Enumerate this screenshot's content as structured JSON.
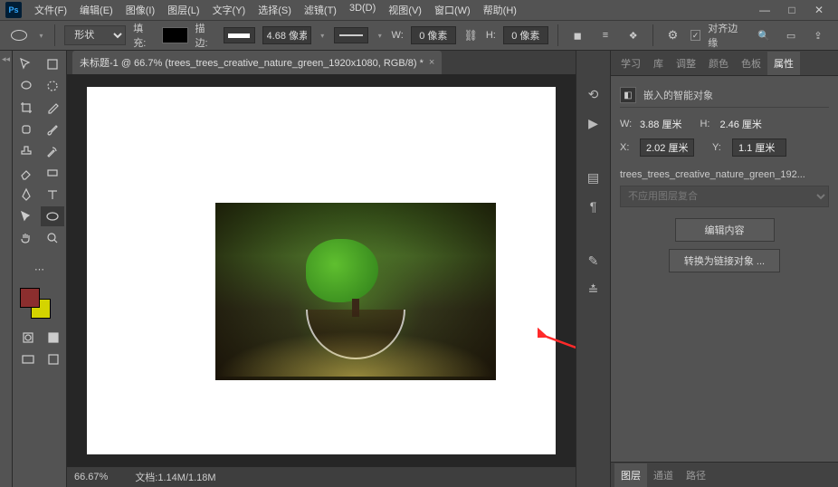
{
  "logo": "Ps",
  "menu": [
    "文件(F)",
    "编辑(E)",
    "图像(I)",
    "图层(L)",
    "文字(Y)",
    "选择(S)",
    "滤镜(T)",
    "3D(D)",
    "视图(V)",
    "窗口(W)",
    "帮助(H)"
  ],
  "optbar": {
    "shape_mode": "形状",
    "fill_label": "填充:",
    "stroke_label": "描边:",
    "stroke_width": "4.68 像素",
    "w_label": "W:",
    "w_val": "0 像素",
    "h_label": "H:",
    "h_val": "0 像素",
    "align_edges": "对齐边缘"
  },
  "doc_tab": "未标题-1 @ 66.7% (trees_trees_creative_nature_green_1920x1080, RGB/8) *",
  "status": {
    "zoom": "66.67%",
    "doc_label": "文档:",
    "doc_size": "1.14M/1.18M"
  },
  "top_tabs": [
    "学习",
    "库",
    "调整",
    "颜色",
    "色板",
    "属性"
  ],
  "props": {
    "title": "嵌入的智能对象",
    "w_label": "W:",
    "w_val": "3.88 厘米",
    "h_label": "H:",
    "h_val": "2.46 厘米",
    "x_label": "X:",
    "x_val": "2.02 厘米",
    "y_label": "Y:",
    "y_val": "1.1 厘米",
    "layer_name": "trees_trees_creative_nature_green_192...",
    "comp_placeholder": "不应用图层复合",
    "edit_btn": "编辑内容",
    "convert_btn": "转换为链接对象 ..."
  },
  "bottom_tabs": [
    "图层",
    "通道",
    "路径"
  ]
}
